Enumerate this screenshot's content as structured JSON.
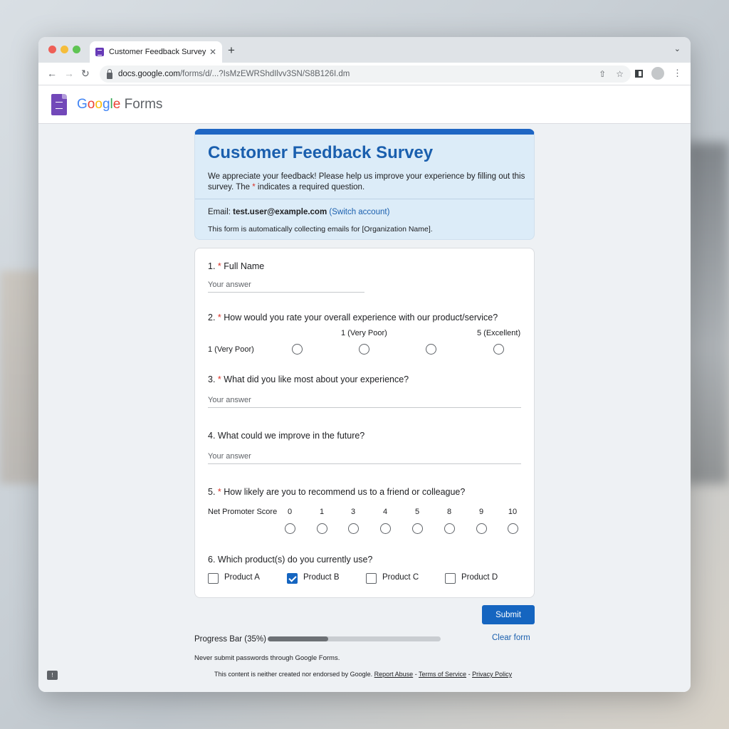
{
  "browser": {
    "tab_title": "Customer Feedback Survey",
    "tab_close": "✕",
    "new_tab": "+",
    "tab_menu": "⌄",
    "url_domain": "docs.google.com",
    "url_path": "/forms/d/...?IsMzEWRShdIlvv3SN/S8B126I.dm"
  },
  "brand": {
    "logo_letters": [
      "G",
      "o",
      "o",
      "g",
      "l",
      "e"
    ],
    "product": " Forms"
  },
  "form": {
    "title": "Customer Feedback Survey",
    "description_a": "We appreciate your feedback! Please help us improve your experience by filling out this survey. The ",
    "description_star": "*",
    "description_b": " indicates a required question.",
    "email_label": "Email: ",
    "email": "test.user@example.com",
    "switch_account": "(Switch account)",
    "collect_note": "This form is automatically collecting emails for [Organization Name].",
    "required_mark": "*"
  },
  "questions": {
    "q1": {
      "number": "1. ",
      "text": "Full Name",
      "placeholder": "Your answer"
    },
    "q2": {
      "number": "2. ",
      "text": "How would you rate your overall experience with our product/service?",
      "scale_header_low": "1 (Very Poor)",
      "scale_header_high": "5 (Excellent)",
      "row_label": "1 (Very Poor)"
    },
    "q3": {
      "number": "3. ",
      "text": "What did you like most about your experience?",
      "placeholder": "Your answer"
    },
    "q4": {
      "number": "4. ",
      "text": "What could we improve in the future?",
      "placeholder": "Your answer"
    },
    "q5": {
      "number": "5. ",
      "text": "How likely are you to recommend us to a friend or colleague?",
      "row_label": "Net Promoter Score",
      "scale": [
        "0",
        "1",
        "3",
        "4",
        "5",
        "8",
        "9",
        "10"
      ]
    },
    "q6": {
      "number": "6. ",
      "text": "Which product(s) do you currently use?",
      "options": [
        {
          "label": "Product A",
          "checked": false
        },
        {
          "label": "Product B",
          "checked": true
        },
        {
          "label": "Product C",
          "checked": false
        },
        {
          "label": "Product D",
          "checked": false
        }
      ]
    }
  },
  "actions": {
    "submit": "Submit",
    "clear": "Clear form"
  },
  "progress": {
    "label": "Progress Bar (35%)",
    "percent": 35
  },
  "footer": {
    "password_note": "Never submit passwords through Google Forms.",
    "disclaimer": "This content is neither created nor endorsed by Google. ",
    "report_abuse": "Report Abuse",
    "sep1": " - ",
    "terms": "Terms of Service",
    "sep2": " - ",
    "privacy": "Privacy Policy",
    "feedback_glyph": "!"
  },
  "colors": {
    "accent": "#1565c0",
    "header_bg": "#dcecf8",
    "required": "#d93025"
  }
}
